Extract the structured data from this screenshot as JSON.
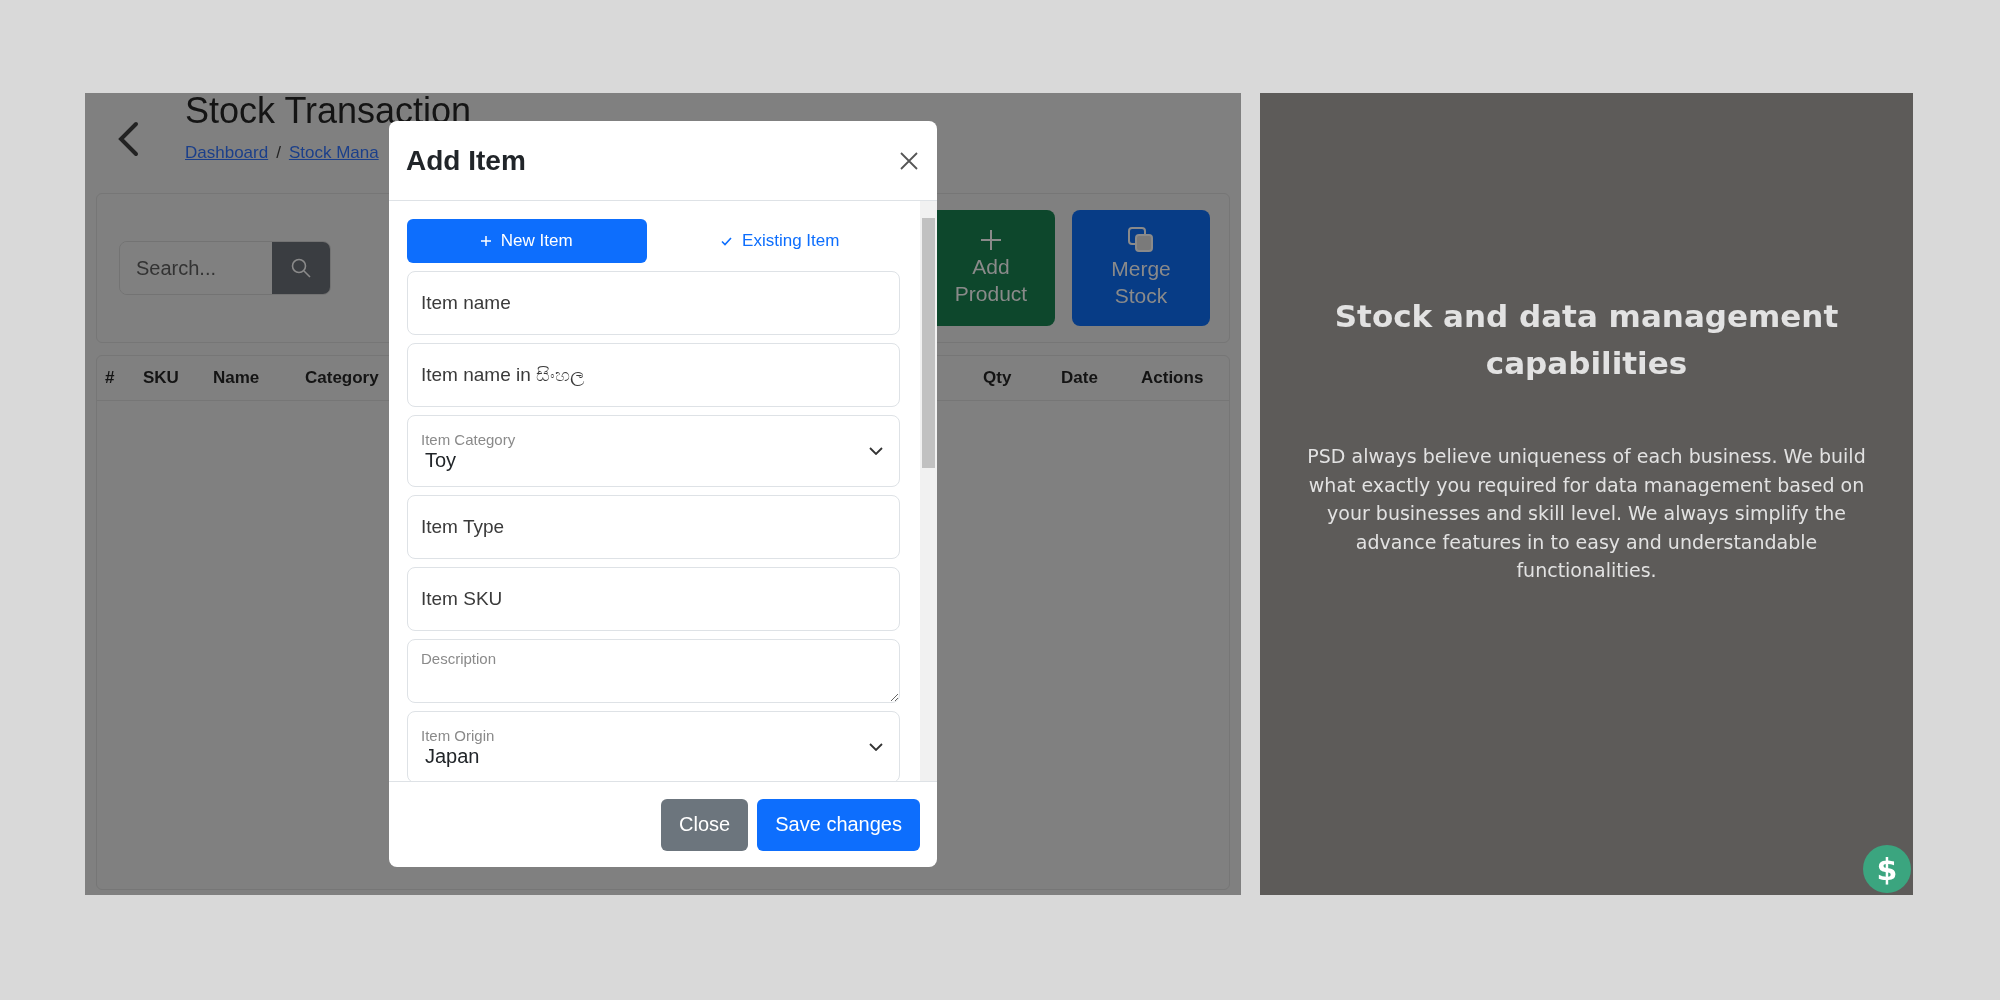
{
  "page": {
    "title": "Stock Transaction",
    "breadcrumb": [
      "Dashboard",
      "Stock Mana"
    ],
    "breadcrumb_separator": "/",
    "search": {
      "placeholder": "Search..."
    },
    "actions": [
      {
        "label": "Add Product",
        "kind": "add"
      },
      {
        "label": "Merge Stock",
        "kind": "merge"
      }
    ],
    "table": {
      "columns": [
        "#",
        "SKU",
        "Name",
        "Category",
        "Qty",
        "Date",
        "Actions"
      ]
    }
  },
  "modal": {
    "title": "Add Item",
    "tabs": [
      {
        "label": "New Item",
        "kind": "new",
        "selected": true
      },
      {
        "label": "Existing Item",
        "kind": "existing",
        "selected": false
      }
    ],
    "fields": [
      {
        "kind": "input",
        "placeholder": "Item name"
      },
      {
        "kind": "input",
        "placeholder": "Item name in සිංහල"
      },
      {
        "kind": "select",
        "label": "Item Category",
        "value": "Toy"
      },
      {
        "kind": "input",
        "placeholder": "Item Type"
      },
      {
        "kind": "input",
        "placeholder": "Item SKU"
      },
      {
        "kind": "textarea",
        "placeholder": "Description"
      },
      {
        "kind": "select",
        "label": "Item Origin",
        "value": "Japan"
      }
    ],
    "buttons": [
      {
        "label": "Close",
        "kind": "secondary"
      },
      {
        "label": "Save changes",
        "kind": "primary"
      }
    ]
  },
  "promo": {
    "heading": "Stock and data management capabilities",
    "body": "PSD always believe uniqueness of each business. We build what exactly you required for data management based on your businesses and skill level. We always simplify the advance features in to easy and understandable functionalities.",
    "badge": "$"
  }
}
